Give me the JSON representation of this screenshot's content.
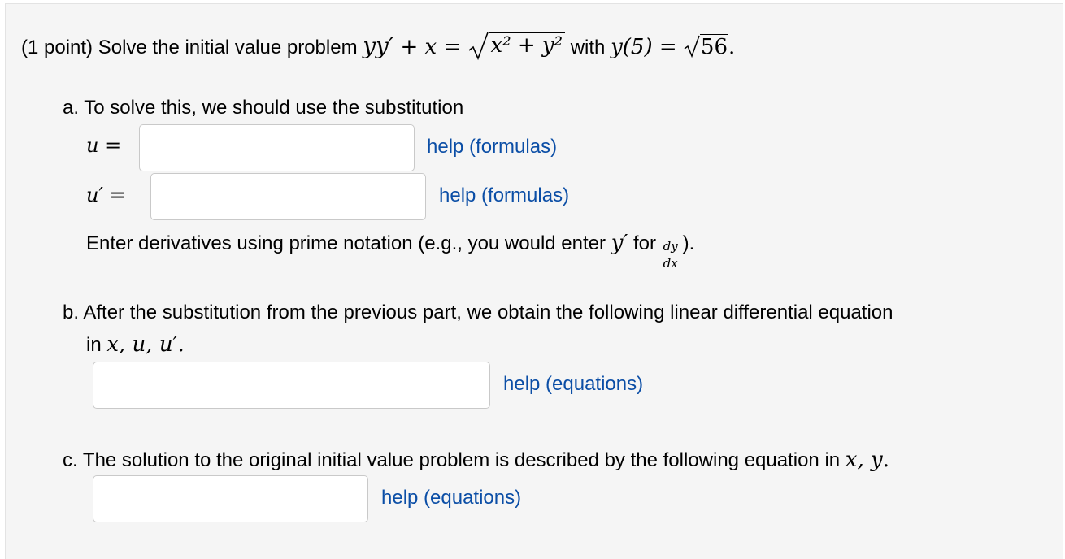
{
  "header": {
    "points": "(1 point)",
    "prompt": "Solve the initial value problem",
    "ode_lhs_y": "yy",
    "ode_prime": "′",
    "ode_plus_x": " + x = ",
    "sqrt_radicand": "x² + y²",
    "with_text": "with",
    "initial_condition": "y(5) = ",
    "ic_value": "56",
    "period": "."
  },
  "part_a": {
    "intro": "a. To solve this, we should use the substitution",
    "u_label": "u =",
    "u_prime_label": "u′ =",
    "u_value": "",
    "u_prime_value": "",
    "u_help": "help (formulas)",
    "u_prime_help": "help (formulas)",
    "note_prefix": "Enter derivatives using prime notation (e.g., you would enter",
    "note_y_prime": "y′",
    "note_for": "for",
    "note_frac_num": "dy",
    "note_frac_den": "dx",
    "note_suffix": ")."
  },
  "part_b": {
    "intro_line1": "b. After the substitution from the previous part, we obtain the following linear differential equation",
    "intro_line2_prefix": "in",
    "intro_line2_vars": "x, u, u′",
    "intro_line2_suffix": ".",
    "value": "",
    "help": "help (equations)"
  },
  "part_c": {
    "intro_prefix": "c. The solution to the original initial value problem is described by the following equation in",
    "intro_vars": "x, y",
    "intro_suffix": ".",
    "value": "",
    "help": "help (equations)"
  }
}
